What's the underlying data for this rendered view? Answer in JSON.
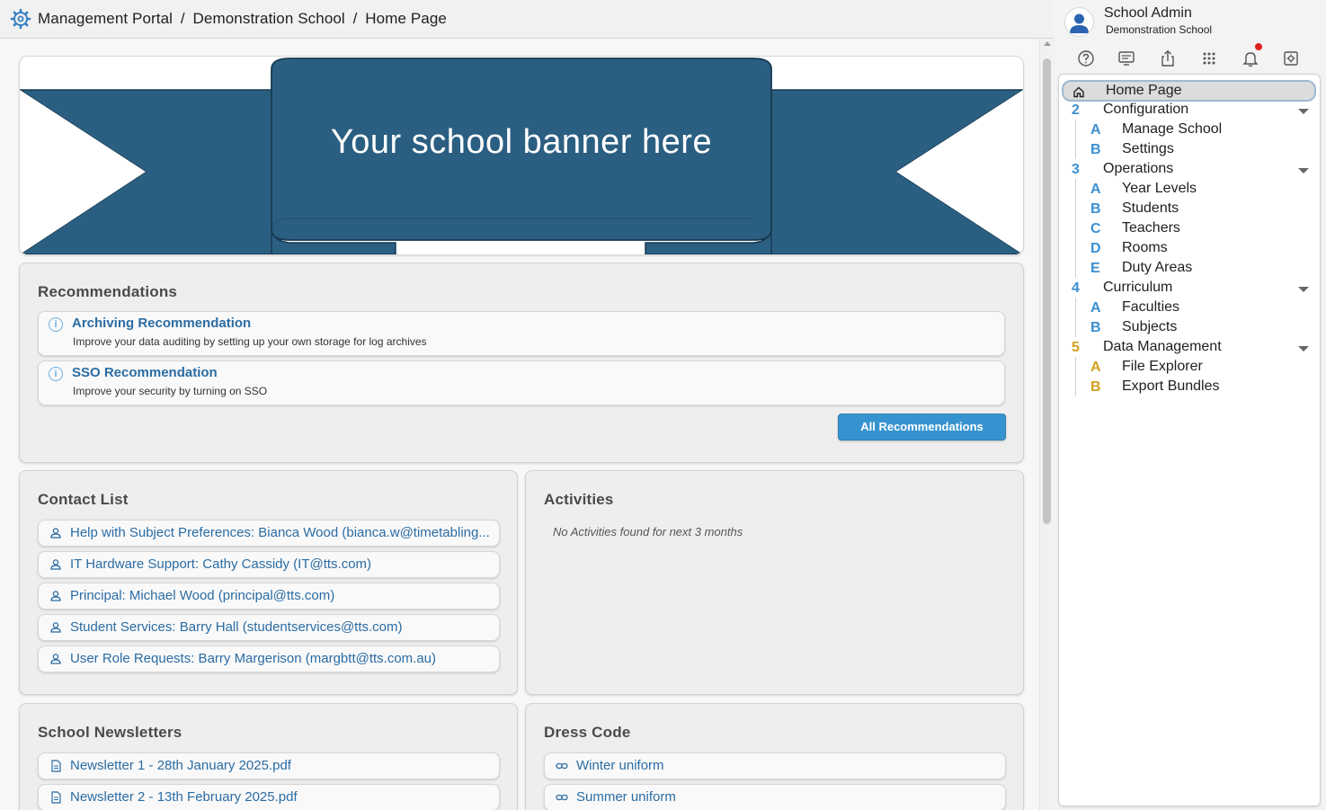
{
  "header": {
    "breadcrumb": [
      "Management Portal",
      "Demonstration School",
      "Home Page"
    ],
    "separator": "/"
  },
  "user": {
    "name": "School Admin",
    "school": "Demonstration School"
  },
  "toolbar_icons": [
    "help-icon",
    "messages-icon",
    "share-icon",
    "apps-grid-icon",
    "notifications-icon",
    "settings-icon"
  ],
  "banner": {
    "text": "Your school banner here",
    "color": "#2b5f82"
  },
  "recommendations": {
    "title": "Recommendations",
    "items": [
      {
        "title": "Archiving Recommendation",
        "description": "Improve your data auditing by setting up your own storage for log archives"
      },
      {
        "title": "SSO Recommendation",
        "description": "Improve your security by turning on SSO"
      }
    ],
    "button": "All Recommendations"
  },
  "contacts": {
    "title": "Contact List",
    "items": [
      "Help with Subject Preferences: Bianca Wood (bianca.w@timetabling...",
      "IT Hardware Support: Cathy Cassidy (IT@tts.com)",
      "Principal: Michael Wood (principal@tts.com)",
      "Student Services: Barry Hall (studentservices@tts.com)",
      "User Role Requests: Barry Margerison (margbtt@tts.com.au)"
    ]
  },
  "activities": {
    "title": "Activities",
    "empty": "No Activities found for next 3 months"
  },
  "newsletters": {
    "title": "School Newsletters",
    "items": [
      "Newsletter 1 - 28th January 2025.pdf",
      "Newsletter 2 - 13th February 2025.pdf"
    ]
  },
  "dress_code": {
    "title": "Dress Code",
    "items": [
      "Winter uniform",
      "Summer uniform"
    ]
  },
  "nav": {
    "home": "Home Page",
    "groups": [
      {
        "num": "2",
        "label": "Configuration",
        "color": "#3b8fd1",
        "items": [
          {
            "letter": "A",
            "label": "Manage School"
          },
          {
            "letter": "B",
            "label": "Settings"
          }
        ]
      },
      {
        "num": "3",
        "label": "Operations",
        "color": "#3b8fd1",
        "items": [
          {
            "letter": "A",
            "label": "Year Levels"
          },
          {
            "letter": "B",
            "label": "Students"
          },
          {
            "letter": "C",
            "label": "Teachers"
          },
          {
            "letter": "D",
            "label": "Rooms"
          },
          {
            "letter": "E",
            "label": "Duty Areas"
          }
        ]
      },
      {
        "num": "4",
        "label": "Curriculum",
        "color": "#3b8fd1",
        "items": [
          {
            "letter": "A",
            "label": "Faculties"
          },
          {
            "letter": "B",
            "label": "Subjects"
          }
        ]
      },
      {
        "num": "5",
        "label": "Data Management",
        "color": "#d4a020",
        "items": [
          {
            "letter": "A",
            "label": "File Explorer"
          },
          {
            "letter": "B",
            "label": "Export Bundles"
          }
        ]
      }
    ]
  }
}
